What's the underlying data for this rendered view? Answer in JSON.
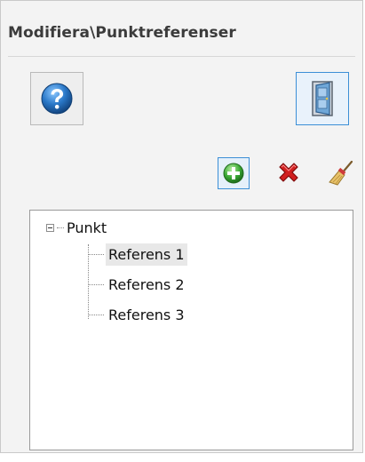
{
  "panel": {
    "title": "Modifiera\\Punktreferenser"
  },
  "toolbar": {
    "help": "help-icon",
    "exit": "exit-door-icon",
    "add": "add-icon",
    "delete": "delete-icon",
    "clear": "broom-icon"
  },
  "tree": {
    "root": "Punkt",
    "children": [
      {
        "label": "Referens 1",
        "selected": true
      },
      {
        "label": "Referens 2",
        "selected": false
      },
      {
        "label": "Referens 3",
        "selected": false
      }
    ]
  },
  "colors": {
    "accent": "#3c8fd6",
    "help_blue": "#2a78c8",
    "add_green": "#3aa935",
    "delete_red": "#d11f1f"
  }
}
